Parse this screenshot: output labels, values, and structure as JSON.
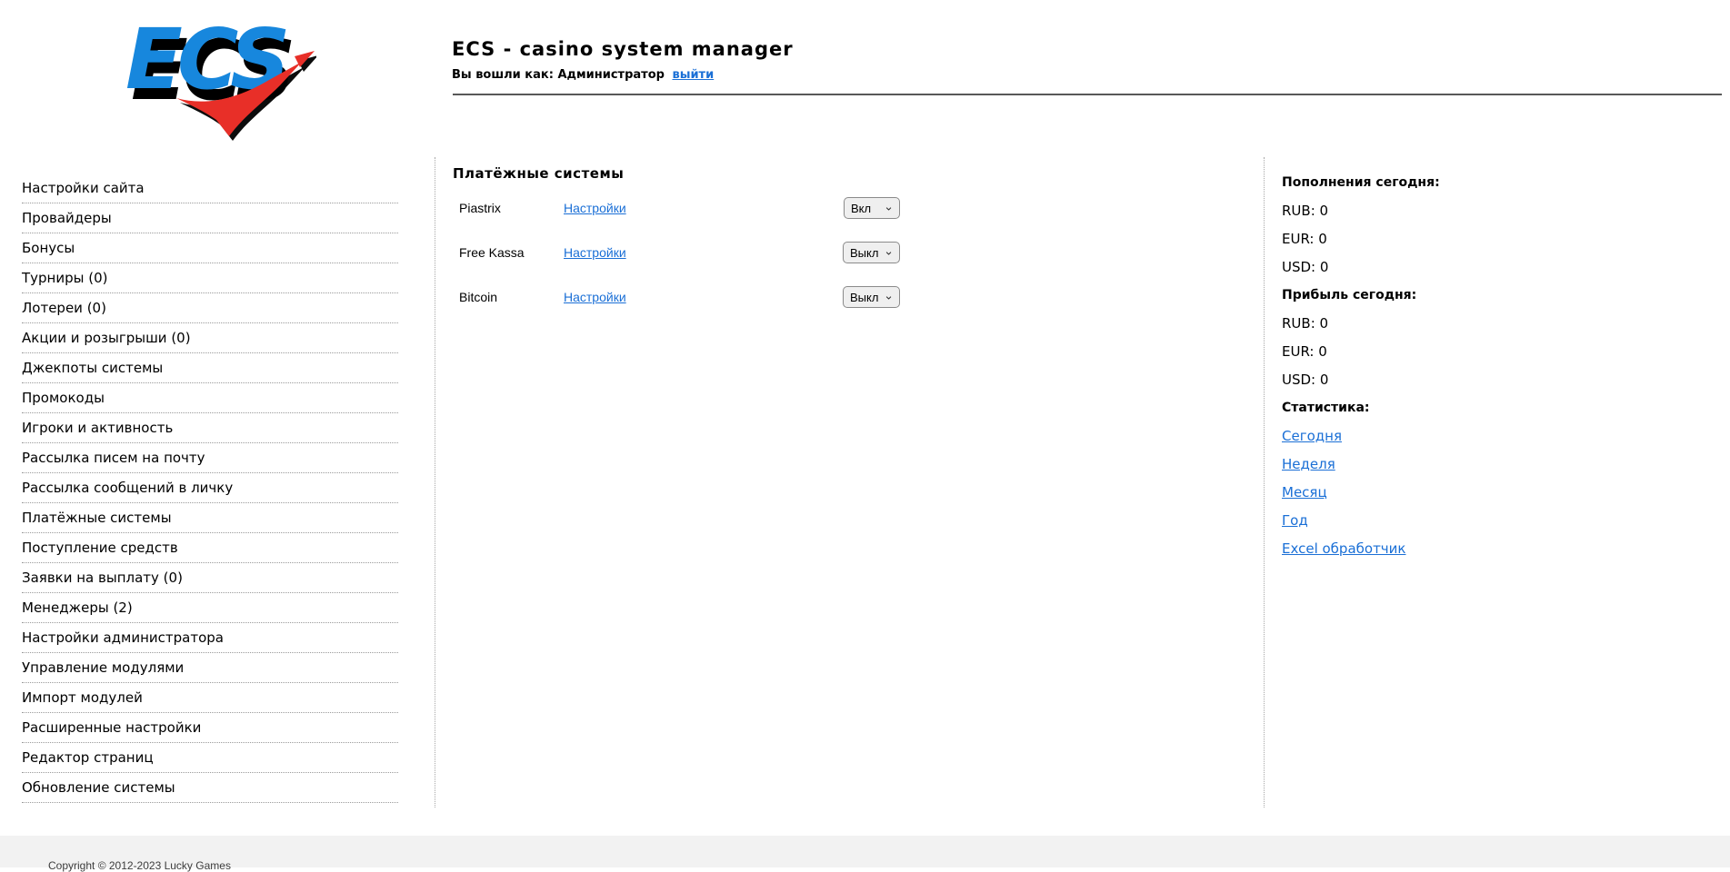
{
  "logo": {
    "text": "ECS"
  },
  "header": {
    "title": "ECS - casino system manager",
    "login_label": "Вы вошли как: Администратор",
    "logout_link": "выйти"
  },
  "sidebar": {
    "items": [
      {
        "label": "Настройки сайта"
      },
      {
        "label": "Провайдеры"
      },
      {
        "label": "Бонусы"
      },
      {
        "label": "Турниры (0)"
      },
      {
        "label": "Лотереи (0)"
      },
      {
        "label": "Акции и розыгрыши (0)"
      },
      {
        "label": "Джекпоты системы"
      },
      {
        "label": "Промокоды"
      },
      {
        "label": "Игроки и активность"
      },
      {
        "label": "Рассылка писем на почту"
      },
      {
        "label": "Рассылка сообщений в личку"
      },
      {
        "label": "Платёжные системы"
      },
      {
        "label": "Поступление средств"
      },
      {
        "label": "Заявки на выплату (0)"
      },
      {
        "label": "Менеджеры (2)"
      },
      {
        "label": "Настройки администратора"
      },
      {
        "label": "Управление модулями"
      },
      {
        "label": "Импорт модулей"
      },
      {
        "label": "Расширенные настройки"
      },
      {
        "label": "Редактор страниц"
      },
      {
        "label": "Обновление системы"
      }
    ]
  },
  "main": {
    "heading": "Платёжные системы",
    "settings_link_label": "Настройки",
    "payment_systems": [
      {
        "name": "Piastrix",
        "status": "Вкл"
      },
      {
        "name": "Free Kassa",
        "status": "Выкл"
      },
      {
        "name": "Bitcoin",
        "status": "Выкл"
      }
    ]
  },
  "right_panel": {
    "deposits_heading": "Пополнения сегодня:",
    "deposits": [
      "RUB: 0",
      "EUR: 0",
      "USD: 0"
    ],
    "profit_heading": "Прибыль сегодня:",
    "profit": [
      "RUB: 0",
      "EUR: 0",
      "USD: 0"
    ],
    "stats_heading": "Статистика:",
    "stats_links": [
      "Сегодня",
      "Неделя",
      "Месяц",
      "Год",
      "Excel обработчик"
    ]
  },
  "footer": {
    "copyright": "Copyright © 2012-2023 Lucky Games"
  },
  "colors": {
    "link": "#1a6fd6",
    "logo_blue": "#1787dd",
    "logo_red": "#e82f28",
    "footer_bg": "#f2f2f2"
  }
}
